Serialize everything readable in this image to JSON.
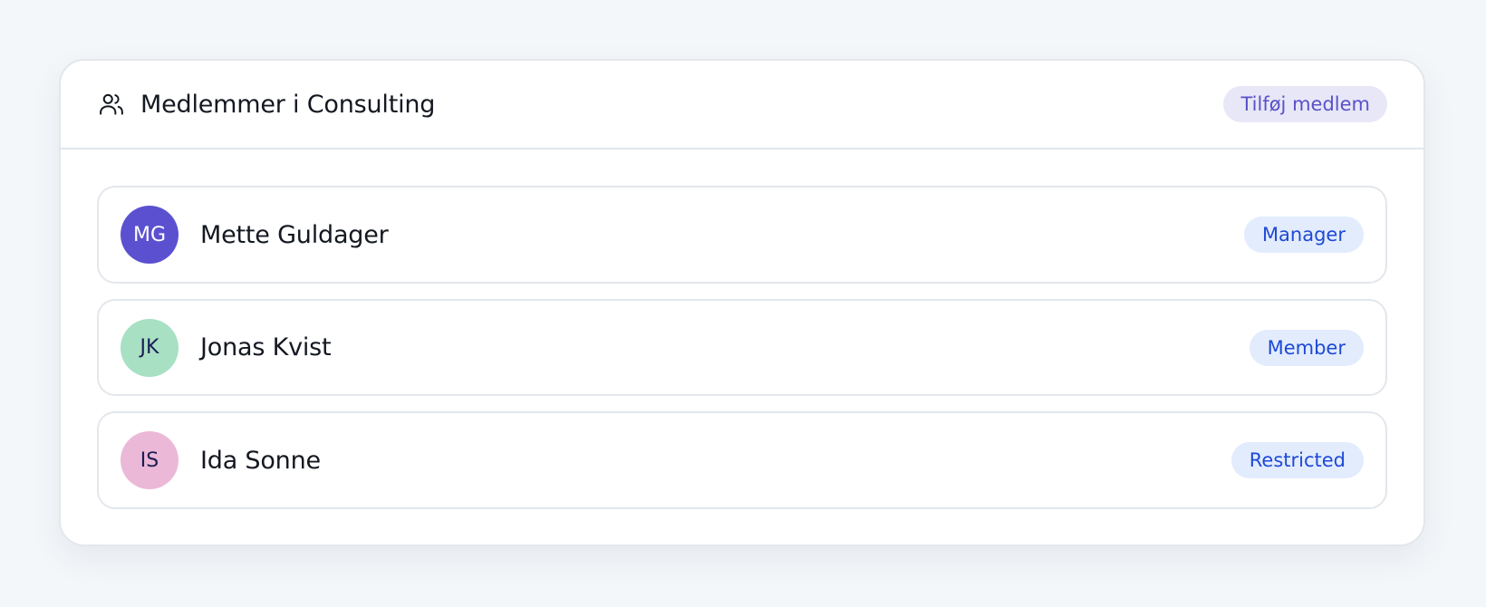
{
  "header": {
    "title": "Medlemmer i Consulting",
    "icon": "users-icon",
    "add_button_label": "Tilføj medlem"
  },
  "members": [
    {
      "initials": "MG",
      "name": "Mette Guldager",
      "role": "Manager",
      "avatar_bg": "#5b51d0",
      "avatar_fg": "#ffffff"
    },
    {
      "initials": "JK",
      "name": "Jonas Kvist",
      "role": "Member",
      "avatar_bg": "#a8e0c4",
      "avatar_fg": "#1b1d55"
    },
    {
      "initials": "IS",
      "name": "Ida Sonne",
      "role": "Restricted",
      "avatar_bg": "#ebb9d7",
      "avatar_fg": "#1b1d55"
    }
  ],
  "colors": {
    "page_bg": "#f4f7fa",
    "card_border": "#e3e7ec",
    "accent": "#5a51c9",
    "badge_bg": "#e2ecfd",
    "badge_text": "#1f49d6"
  }
}
